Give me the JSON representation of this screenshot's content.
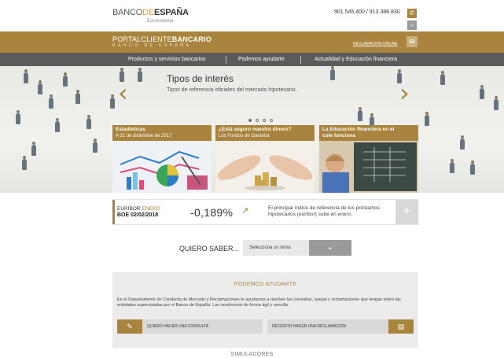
{
  "header": {
    "logo_main": "BANCO",
    "logo_de": "DE",
    "logo_end": "ESPAÑA",
    "logo_sub": "Eurosistema",
    "phone": "901.545.400 / 913.388.830"
  },
  "portal": {
    "title_a": "PORTALCLIENTE",
    "title_b": "BANCARIO",
    "subtitle": "BANCO DE ESPAÑA",
    "reclamacion": "RECLAMACIÓN ONLINE"
  },
  "nav": {
    "items": [
      {
        "label": "Productos y servicios bancarios"
      },
      {
        "label": "Podemos ayudarte"
      },
      {
        "label": "Actualidad y Educación financiera"
      }
    ]
  },
  "hero": {
    "title": "Tipos de interés",
    "subtitle": "Tipos de referencia oficiales del mercado hipotecario."
  },
  "cards": [
    {
      "title": "Estadísticas",
      "subtitle": "A 31 de diciembre de 2017"
    },
    {
      "title": "¿Está seguro nuestro dinero?",
      "subtitle": "Los Fondos de Garantía"
    },
    {
      "title": "La Educación financiera en el",
      "subtitle": "cole funciona"
    }
  ],
  "euribor": {
    "name": "EURÍBOR",
    "month": "ENERO",
    "date": "BOE 02/02/2018",
    "value": "-0,189%",
    "text": "El principal índice de referencia de los préstamos hipotecarios (euríbor) sube en enero.",
    "plus": "+"
  },
  "quiero": {
    "label": "QUIERO SABER...",
    "select": "Selecciona un tema"
  },
  "ayuda": {
    "title": "PODEMOS AYUDARTE",
    "text": "En el Departamento de Conducta de Mercado y Reclamaciones te ayudamos a resolver las consultas, quejas y reclamaciones que tengas sobre las entidades supervisadas por el Banco de España. Las resolvemos de forma ágil y sencilla.",
    "btn_consulta": "QUIERO HACER UNA CONSULTA",
    "btn_reclamacion": "NECESITO HACER UNA RECLAMACIÓN"
  },
  "simuladores": "SIMULADORES",
  "colors": {
    "brand_gold": "#a8843e",
    "nav_grey": "#5b5b5b"
  }
}
